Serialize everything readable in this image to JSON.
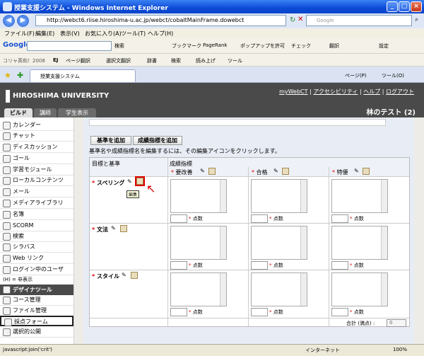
{
  "window": {
    "title": "授業支援システム - Windows Internet Explorer",
    "min": "_",
    "max": "□",
    "close": "×"
  },
  "address": {
    "url": "http://webct6.riise.hiroshima-u.ac.jp/webct/cobaltMainFrame.dowebct",
    "search_placeholder": "Google"
  },
  "menu": [
    "ファイル(F)",
    "編集(E)",
    "表示(V)",
    "お気に入り(A)",
    "ツール(T)",
    "ヘルプ(H)"
  ],
  "google_bar": {
    "logo": "Google",
    "search_btn": "検索",
    "bookmark": "ブックマーク",
    "pagerank": "PageRank",
    "popup": "ポップアップを許可",
    "check": "チェック",
    "translate": "翻訳",
    "settings": "設定"
  },
  "koji_bar": [
    "コリャ英和！2008",
    "EJ",
    "ページ翻訳",
    "選択文翻訳",
    "辞書",
    "検索",
    "読み上げ",
    "ツール"
  ],
  "tab": {
    "label": "授業支援システム",
    "page": "ページ(P)",
    "tools": "ツール(O)"
  },
  "header": {
    "university": "HIROSHIMA UNIVERSITY",
    "links": [
      "myWebCT",
      "アクセシビリティ",
      "ヘルプ",
      "ログアウト"
    ],
    "course": "林のテスト (2)",
    "tabs": [
      "ビルド",
      "講師",
      "学生表示"
    ]
  },
  "sidebar": {
    "items": [
      "カレンダー",
      "チャット",
      "ディスカッション",
      "ゴール",
      "学習モジュール",
      "ローカルコンテンツ",
      "メール",
      "メディアライブラリ",
      "名簿",
      "SCORM",
      "検索",
      "シラバス",
      "Web リンク",
      "ログイン中のユーザ"
    ],
    "note": "(H) = 非表示",
    "designer_tools": "デザイナツール",
    "tools": [
      "コース管理",
      "ファイル管理",
      "採点フォーム",
      "選択的公開"
    ]
  },
  "main": {
    "add_criterion": "基準を追加",
    "add_level": "成績指標を追加",
    "instruction": "基準名や成績指標名を編集するには、その編集アイコンをクリックします。",
    "col_criteria": "目標と基準",
    "col_levels": "成績指標",
    "levels": [
      "要改善",
      "合格",
      "特優"
    ],
    "criteria": [
      "スペリング",
      "文法",
      "スタイル"
    ],
    "points_label": "点数",
    "tooltip": "編集",
    "total_label": "合計 (満点) :",
    "total_value": "0"
  },
  "status": {
    "left": "javascript:join('crit')",
    "zone": "インターネット",
    "zoom": "100%"
  }
}
